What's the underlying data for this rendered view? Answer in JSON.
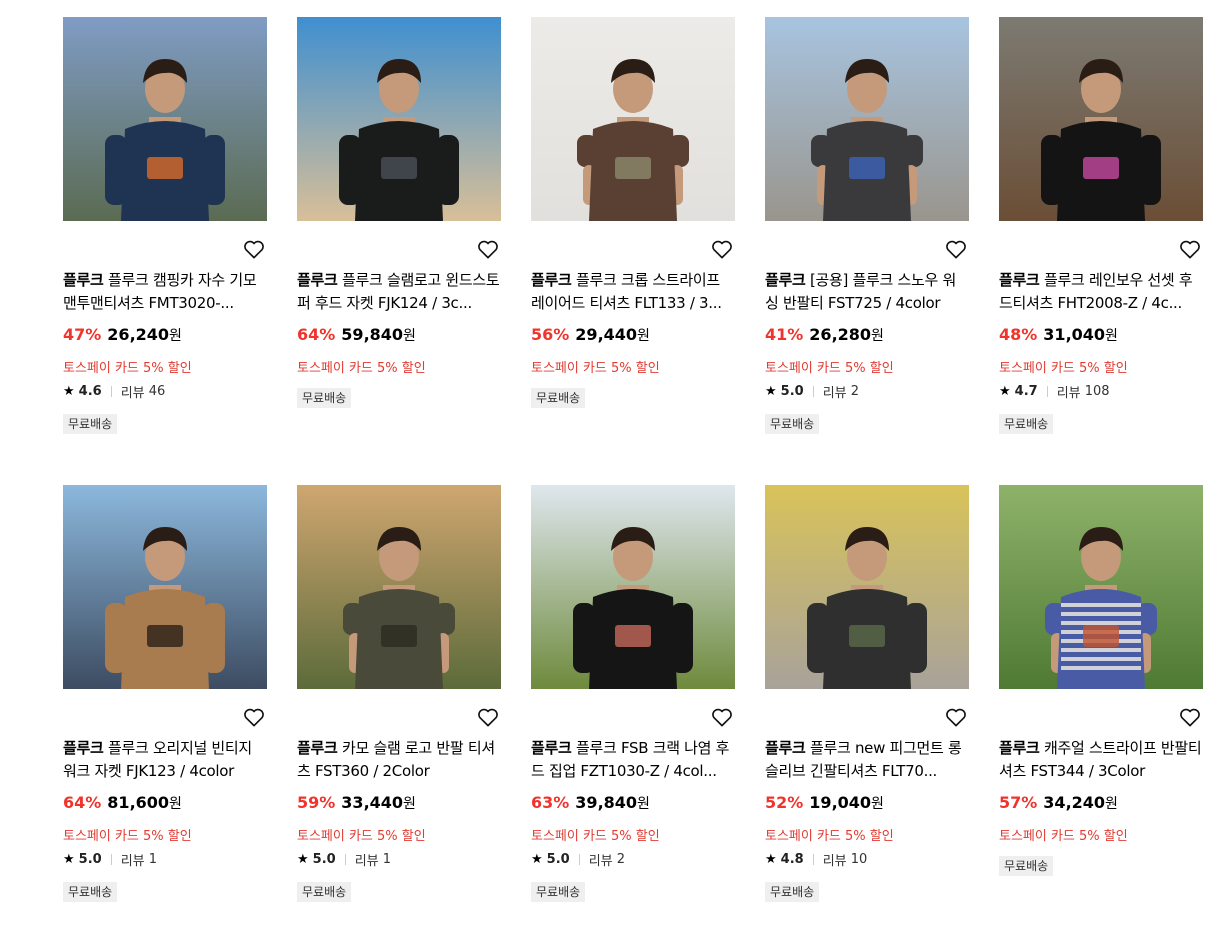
{
  "products": [
    {
      "brand": "플루크",
      "name": "플루크 캠핑카 자수 기모 맨투맨티셔츠 FMT3020-...",
      "discount": "47%",
      "price": "26,240",
      "currency": "원",
      "promo": "토스페이 카드 5% 할인",
      "rating": "4.6",
      "review_label": "리뷰",
      "reviews": "46",
      "badge": "무료배송",
      "has_rating": true,
      "image_desc": "navy-sweatshirt-camper",
      "colors": {
        "bg1": "#7f9cc4",
        "bg2": "#5b6b52",
        "garment": "#1f3352",
        "accent": "#d96a2b"
      }
    },
    {
      "brand": "플루크",
      "name": "플루크 슬램로고 윈드스토퍼 후드 자켓 FJK124 / 3c...",
      "discount": "64%",
      "price": "59,840",
      "currency": "원",
      "promo": "토스페이 카드 5% 할인",
      "rating": "",
      "review_label": "",
      "reviews": "",
      "badge": "무료배송",
      "has_rating": false,
      "image_desc": "black-hooded-jacket-desert",
      "colors": {
        "bg1": "#3f8fd0",
        "bg2": "#d8bf98",
        "garment": "#1a1c1c",
        "accent": "#4a4f58"
      }
    },
    {
      "brand": "플루크",
      "name": "플루크 크롭 스트라이프 레이어드 티셔츠 FLT133 / 3...",
      "discount": "56%",
      "price": "29,440",
      "currency": "원",
      "promo": "토스페이 카드 5% 할인",
      "rating": "",
      "review_label": "",
      "reviews": "",
      "badge": "무료배송",
      "has_rating": false,
      "image_desc": "brown-layered-tee-studio",
      "colors": {
        "bg1": "#ecebe8",
        "bg2": "#e2e0dc",
        "garment": "#5a3f33",
        "accent": "#8c8a6b"
      }
    },
    {
      "brand": "플루크",
      "name": "[공용] 플루크 스노우 워싱 반팔티 FST725 / 4color",
      "discount": "41%",
      "price": "26,280",
      "currency": "원",
      "promo": "토스페이 카드 5% 할인",
      "rating": "5.0",
      "review_label": "리뷰",
      "reviews": "2",
      "badge": "무료배송",
      "has_rating": true,
      "image_desc": "washed-black-tee-skatepark",
      "colors": {
        "bg1": "#a7c4e0",
        "bg2": "#9a958d",
        "garment": "#3a3a3c",
        "accent": "#3c63b8"
      }
    },
    {
      "brand": "플루크",
      "name": "플루크 레인보우 선셋 후드티셔츠 FHT2008-Z / 4c...",
      "discount": "48%",
      "price": "31,040",
      "currency": "원",
      "promo": "토스페이 카드 5% 할인",
      "rating": "4.7",
      "review_label": "리뷰",
      "reviews": "108",
      "badge": "무료배송",
      "has_rating": true,
      "image_desc": "black-hoodie-rainbow-print",
      "colors": {
        "bg1": "#7c7a72",
        "bg2": "#6b4e36",
        "garment": "#141414",
        "accent": "#c64aa0"
      }
    },
    {
      "brand": "플루크",
      "name": "플루크 오리지널 빈티지 워크 자켓 FJK123 / 4color",
      "discount": "64%",
      "price": "81,600",
      "currency": "원",
      "promo": "토스페이 카드 5% 할인",
      "rating": "5.0",
      "review_label": "리뷰",
      "reviews": "1",
      "badge": "무료배송",
      "has_rating": true,
      "image_desc": "tan-work-jacket",
      "colors": {
        "bg1": "#8cb8dc",
        "bg2": "#3d4c62",
        "garment": "#a87c4e",
        "accent": "#2b2118"
      }
    },
    {
      "brand": "플루크",
      "name": "카모 슬램 로고 반팔 티셔츠 FST360 / 2Color",
      "discount": "59%",
      "price": "33,440",
      "currency": "원",
      "promo": "토스페이 카드 5% 할인",
      "rating": "5.0",
      "review_label": "리뷰",
      "reviews": "1",
      "badge": "무료배송",
      "has_rating": true,
      "image_desc": "camo-tee-beach-sunset",
      "colors": {
        "bg1": "#cfa670",
        "bg2": "#5c6b3a",
        "garment": "#4a4a3a",
        "accent": "#2a2a22"
      }
    },
    {
      "brand": "플루크",
      "name": "플루크 FSB 크랙 나염 후드 집업 FZT1030-Z / 4col...",
      "discount": "63%",
      "price": "39,840",
      "currency": "원",
      "promo": "토스페이 카드 5% 할인",
      "rating": "5.0",
      "review_label": "리뷰",
      "reviews": "2",
      "badge": "무료배송",
      "has_rating": true,
      "image_desc": "black-zip-hoodie-bridge",
      "colors": {
        "bg1": "#dfe7ee",
        "bg2": "#6e8a3c",
        "garment": "#151515",
        "accent": "#c4685a"
      }
    },
    {
      "brand": "플루크",
      "name": "플루크 new 피그먼트 롱슬리브 긴팔티셔츠 FLT70...",
      "discount": "52%",
      "price": "19,040",
      "currency": "원",
      "promo": "토스페이 카드 5% 할인",
      "rating": "4.8",
      "review_label": "리뷰",
      "reviews": "10",
      "badge": "무료배송",
      "has_rating": true,
      "image_desc": "charcoal-longsleeve-graffiti",
      "colors": {
        "bg1": "#d8c35a",
        "bg2": "#a8a29a",
        "garment": "#2f2f2f",
        "accent": "#5b6a4a"
      }
    },
    {
      "brand": "플루크",
      "name": "캐주얼 스트라이프 반팔티셔츠 FST344 / 3Color",
      "discount": "57%",
      "price": "34,240",
      "currency": "원",
      "promo": "토스페이 카드 5% 할인",
      "rating": "",
      "review_label": "",
      "reviews": "",
      "badge": "무료배송",
      "has_rating": false,
      "image_desc": "striped-tee-park",
      "colors": {
        "bg1": "#8fb26a",
        "bg2": "#4f7a34",
        "garment": "#4a5ba6",
        "accent": "#c3542f"
      }
    }
  ]
}
